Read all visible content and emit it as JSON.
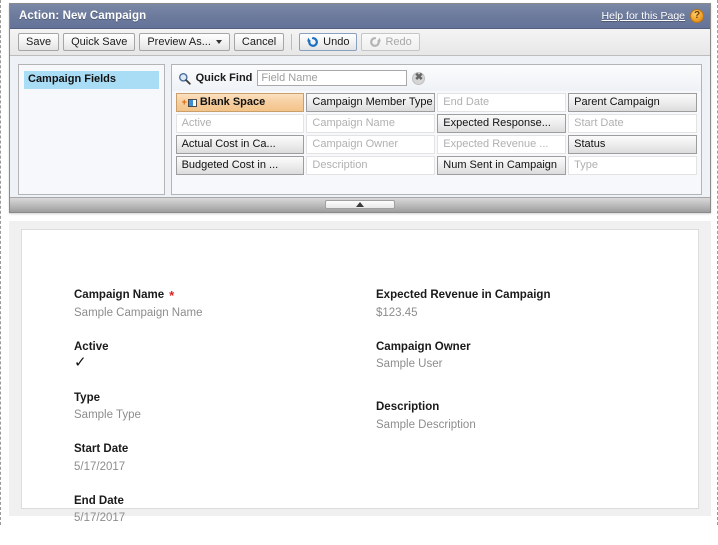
{
  "header": {
    "title": "Action: New Campaign",
    "help_label": "Help for this Page",
    "help_icon": "question-mark-icon",
    "bar_color": "#6c7a9c"
  },
  "toolbar": {
    "save_label": "Save",
    "quick_save_label": "Quick Save",
    "preview_as_label": "Preview As...",
    "cancel_label": "Cancel",
    "undo_label": "Undo",
    "redo_label": "Redo",
    "undo_icon": "undo-circular-arrow-icon",
    "redo_icon": "redo-circular-arrow-icon",
    "redo_disabled": true
  },
  "sidebar": {
    "items": [
      {
        "label": "Campaign Fields",
        "selected": true
      }
    ],
    "highlight_color": "#a9ddf5"
  },
  "quick_find": {
    "icon": "magnifier-icon",
    "label": "Quick Find",
    "placeholder": "Field Name",
    "value": "",
    "clear_icon": "clear-x-icon"
  },
  "palette": {
    "fields": [
      {
        "label": "Blank Space",
        "state": "blank",
        "icon": "blank-space-icon"
      },
      {
        "label": "Campaign Member Type",
        "state": "available"
      },
      {
        "label": "End Date",
        "state": "used"
      },
      {
        "label": "Parent Campaign",
        "state": "available"
      },
      {
        "label": "Active",
        "state": "used"
      },
      {
        "label": "Campaign Name",
        "state": "used"
      },
      {
        "label": "Expected Response...",
        "state": "available"
      },
      {
        "label": "Start Date",
        "state": "used"
      },
      {
        "label": "Actual Cost in Ca...",
        "state": "available"
      },
      {
        "label": "Campaign Owner",
        "state": "used"
      },
      {
        "label": "Expected Revenue ...",
        "state": "used"
      },
      {
        "label": "Status",
        "state": "available"
      },
      {
        "label": "Budgeted Cost in ...",
        "state": "available"
      },
      {
        "label": "Description",
        "state": "used"
      },
      {
        "label": "Num Sent in Campaign",
        "state": "available"
      },
      {
        "label": "Type",
        "state": "used"
      }
    ]
  },
  "splitter": {
    "collapse_icon": "collapse-up-arrow-icon"
  },
  "preview": {
    "left_column": [
      {
        "label": "Campaign Name",
        "required": true,
        "value": "Sample Campaign Name",
        "type": "text"
      },
      {
        "label": "Active",
        "required": false,
        "value": "✓",
        "type": "checkbox"
      },
      {
        "label": "Type",
        "required": false,
        "value": "Sample Type",
        "type": "text"
      },
      {
        "label": "Start Date",
        "required": false,
        "value": "5/17/2017",
        "type": "text"
      },
      {
        "label": "End Date",
        "required": false,
        "value": "5/17/2017",
        "type": "text"
      }
    ],
    "right_column": [
      {
        "label": "Expected Revenue in Campaign",
        "required": false,
        "value": "$123.45",
        "type": "text"
      },
      {
        "label": "Campaign Owner",
        "required": false,
        "value": "Sample User",
        "type": "text"
      },
      {
        "label": "Description",
        "required": false,
        "value": "Sample Description",
        "type": "text"
      }
    ]
  }
}
